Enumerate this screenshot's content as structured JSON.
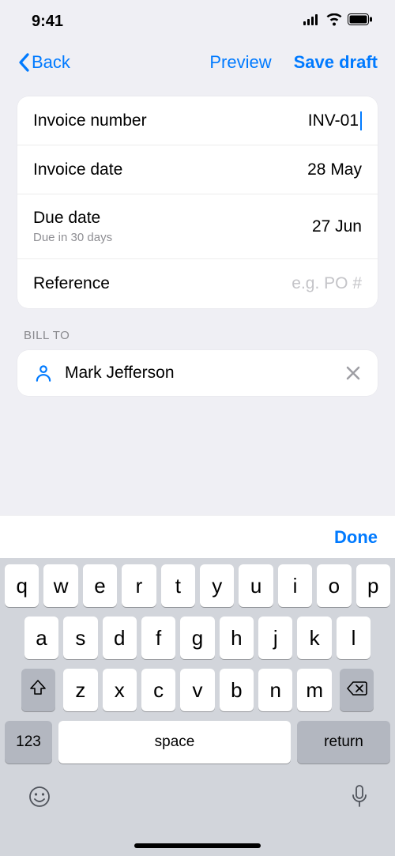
{
  "status": {
    "time": "9:41"
  },
  "nav": {
    "back_label": "Back",
    "preview_label": "Preview",
    "save_draft_label": "Save draft"
  },
  "form": {
    "rows": {
      "invoice_number": {
        "label": "Invoice number",
        "value": "INV-01"
      },
      "invoice_date": {
        "label": "Invoice date",
        "value": "28 May"
      },
      "due_date": {
        "label": "Due date",
        "subtext": "Due in 30 days",
        "value": "27 Jun"
      },
      "reference": {
        "label": "Reference",
        "placeholder": "e.g. PO #"
      }
    }
  },
  "bill_to": {
    "section_header": "BILL TO",
    "contact_name": "Mark Jefferson"
  },
  "keyboard": {
    "done_label": "Done",
    "row1": [
      "q",
      "w",
      "e",
      "r",
      "t",
      "y",
      "u",
      "i",
      "o",
      "p"
    ],
    "row2": [
      "a",
      "s",
      "d",
      "f",
      "g",
      "h",
      "j",
      "k",
      "l"
    ],
    "row3": [
      "z",
      "x",
      "c",
      "v",
      "b",
      "n",
      "m"
    ],
    "num_label": "123",
    "space_label": "space",
    "return_label": "return"
  }
}
